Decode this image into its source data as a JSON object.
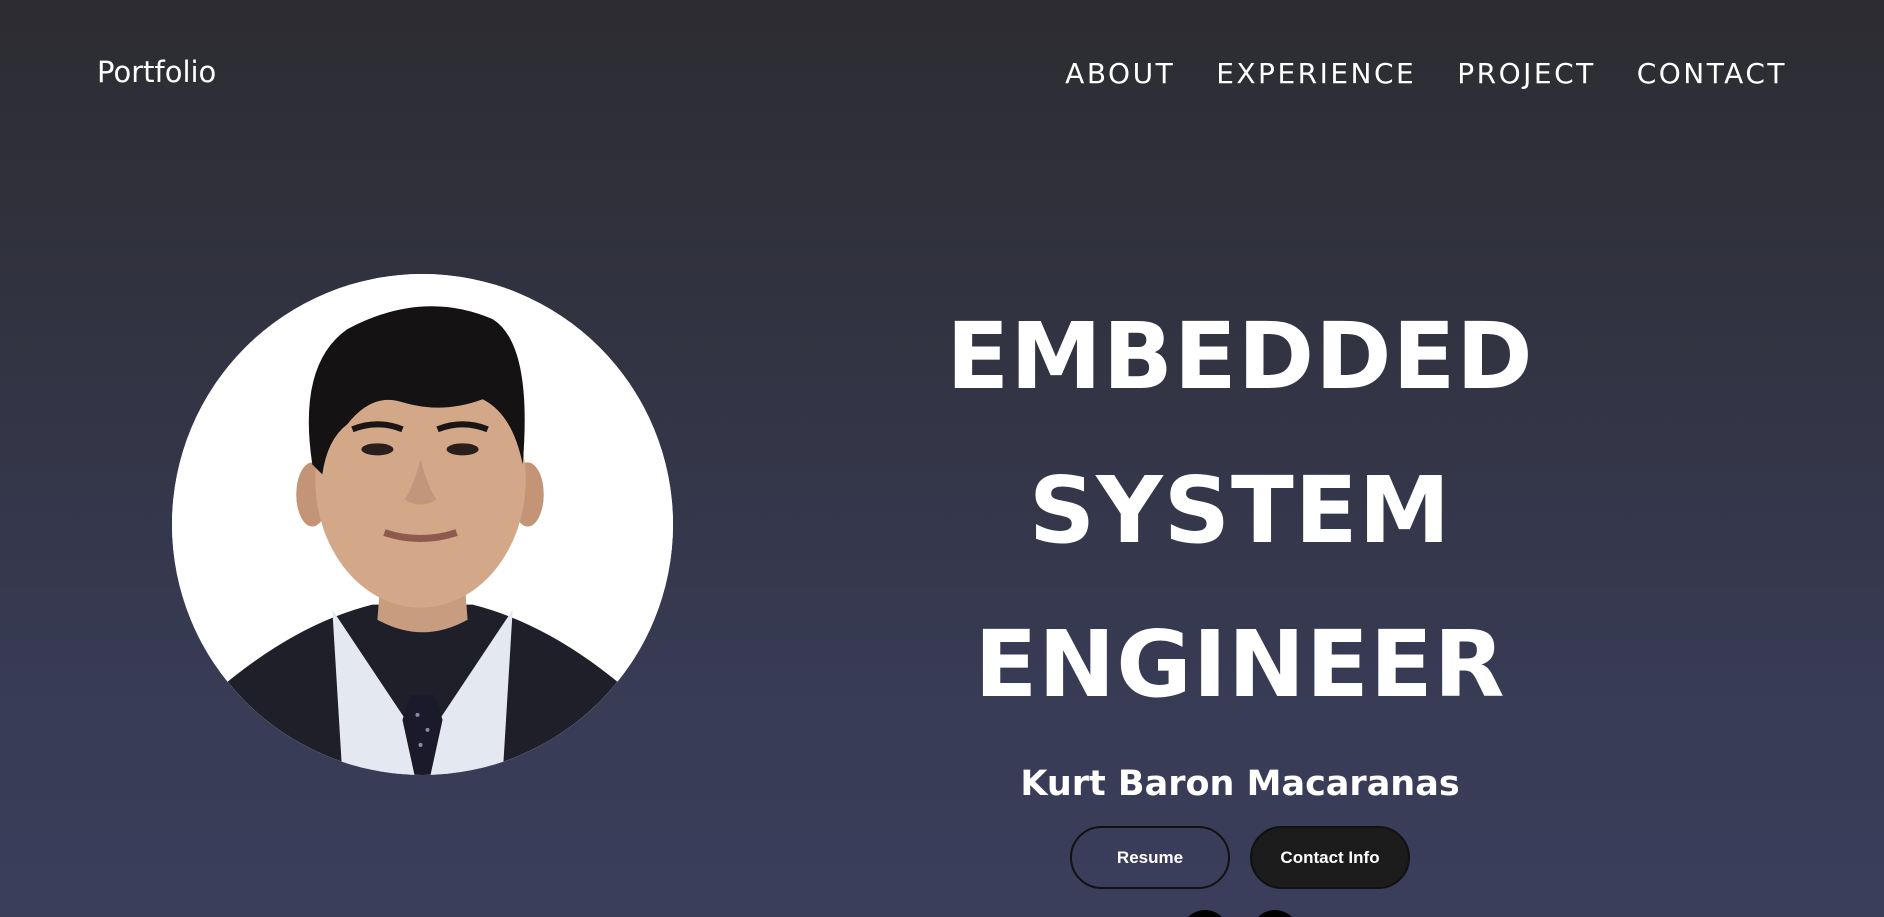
{
  "nav": {
    "logo": "Portfolio",
    "links": [
      "ABOUT",
      "EXPERIENCE",
      "PROJECT",
      "CONTACT"
    ]
  },
  "hero": {
    "title_line1": "EMBEDDED SYSTEM",
    "title_line2": "ENGINEER",
    "name": "Kurt Baron Macaranas",
    "buttons": {
      "resume": "Resume",
      "contact": "Contact Info"
    },
    "socials": [
      {
        "icon": "facebook-icon"
      },
      {
        "icon": "github-icon"
      }
    ]
  },
  "colors": {
    "background_top": "#2c2c31",
    "background_bottom": "#3a3e5b",
    "text": "#ffffff",
    "contact_button": "#1c1c1c"
  }
}
